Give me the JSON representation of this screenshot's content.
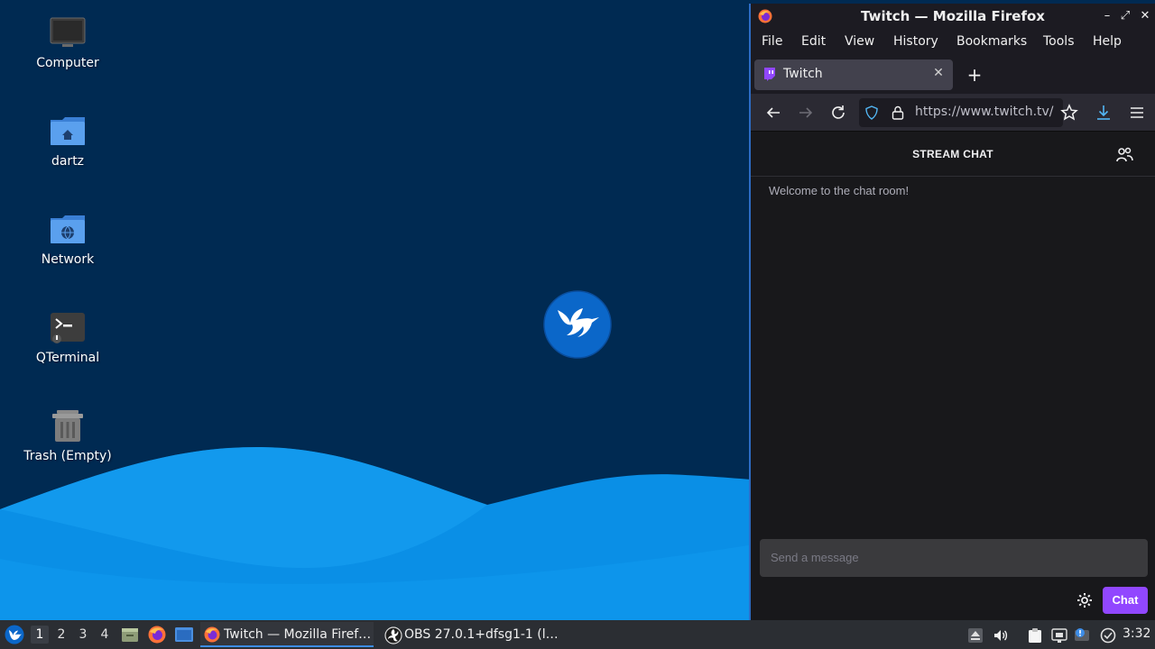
{
  "desktop": {
    "icons": [
      {
        "label": "Computer",
        "icon": "computer-icon"
      },
      {
        "label": "dartz",
        "icon": "home-folder-icon"
      },
      {
        "label": "Network",
        "icon": "network-folder-icon"
      },
      {
        "label": "QTerminal",
        "icon": "terminal-icon"
      },
      {
        "label": "Trash (Empty)",
        "icon": "trash-icon"
      }
    ],
    "wallpaper_logo": "hummingbird-logo"
  },
  "firefox": {
    "window_title": "Twitch — Mozilla Firefox",
    "window_buttons": {
      "minimize": "–",
      "maximize": "⤢",
      "close": "✕"
    },
    "menu": [
      "File",
      "Edit",
      "View",
      "History",
      "Bookmarks",
      "Tools",
      "Help"
    ],
    "tab": {
      "title": "Twitch",
      "close": "✕",
      "icon": "twitch-icon"
    },
    "new_tab_symbol": "+",
    "url": "https://www.twitch.tv/",
    "page": {
      "chat_title": "STREAM CHAT",
      "welcome": "Welcome to the chat room!",
      "input_placeholder": "Send a message",
      "chat_button": "Chat"
    }
  },
  "taskbar": {
    "workspaces": [
      "1",
      "2",
      "3",
      "4"
    ],
    "active_workspace": "1",
    "tasks": [
      {
        "label": "Twitch — Mozilla Firef…",
        "icon": "firefox-icon",
        "active": true
      },
      {
        "label": "OBS 27.0.1+dfsg1-1 (l…",
        "icon": "obs-icon",
        "active": false
      }
    ],
    "clock": "3:32"
  },
  "colors": {
    "desktop_bg": "#002a52",
    "wave_light": "#0a8fe6",
    "accent_blue": "#2d6cc4",
    "twitch_purple": "#9147ff",
    "taskbar_bg": "#2b2e33"
  }
}
